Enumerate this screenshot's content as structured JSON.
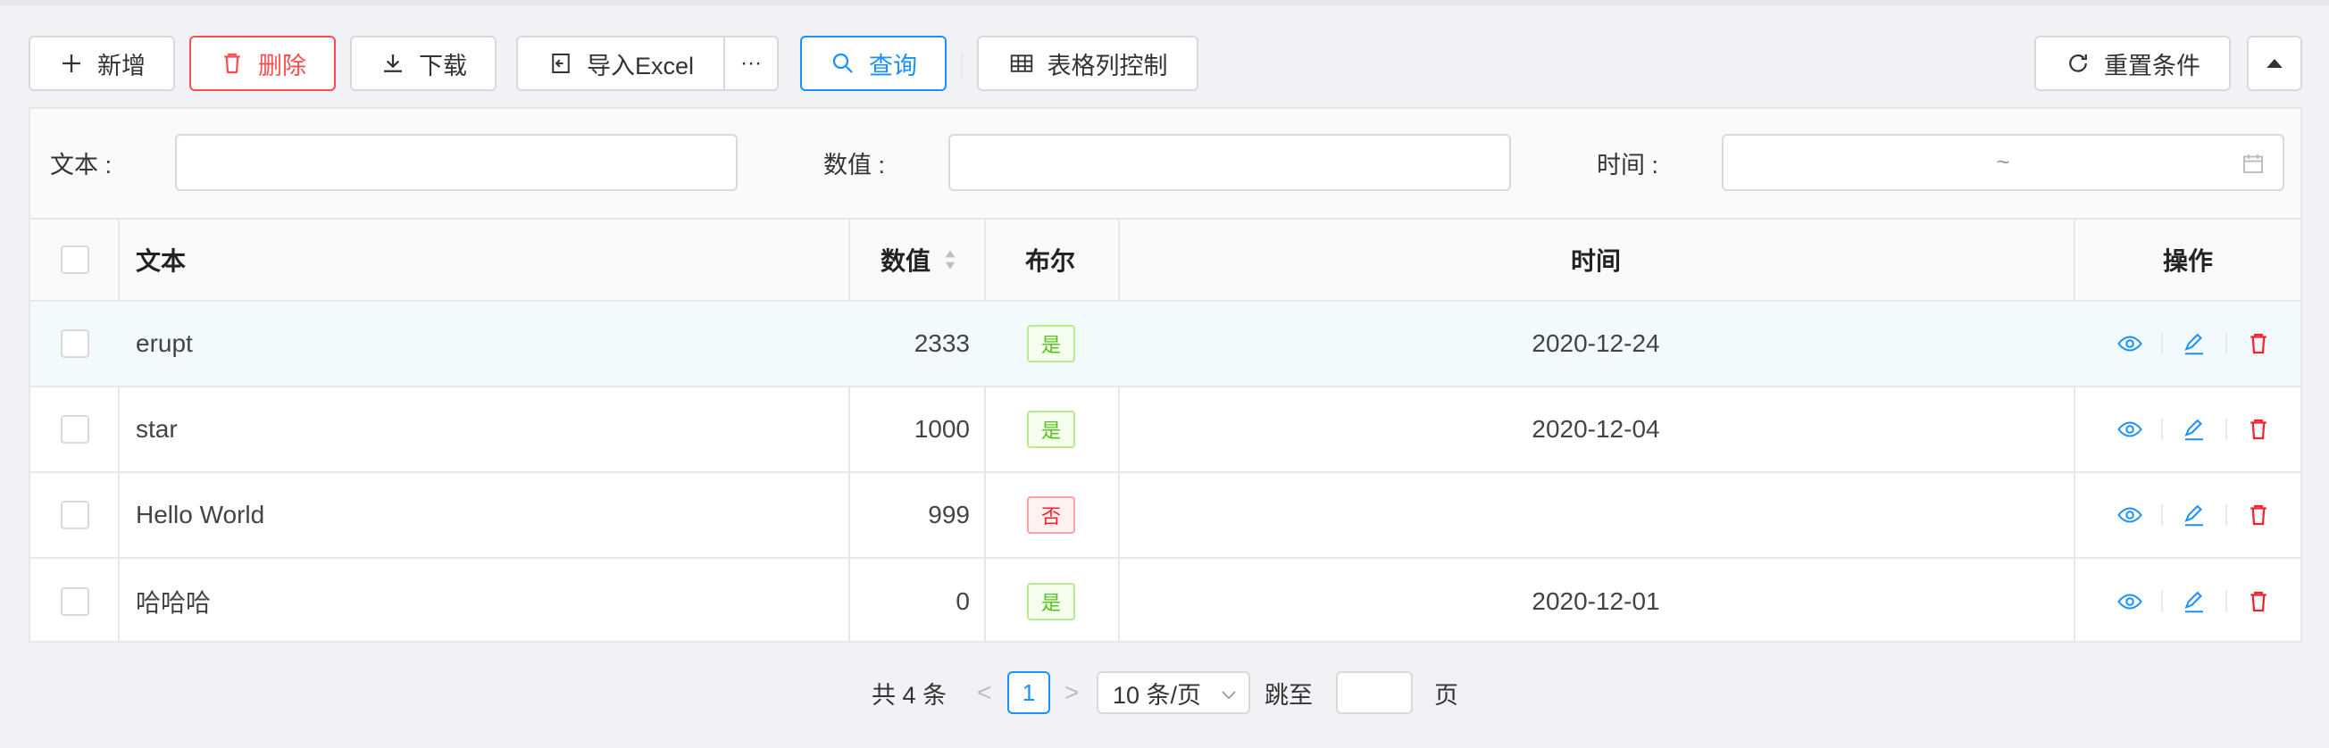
{
  "toolbar": {
    "add_label": "新增",
    "delete_label": "删除",
    "download_label": "下载",
    "import_label": "导入Excel",
    "more_label": "···",
    "query_label": "查询",
    "columns_label": "表格列控制",
    "reset_label": "重置条件"
  },
  "search": {
    "text_label": "文本 :",
    "number_label": "数值 :",
    "time_label": "时间 :",
    "text_value": "",
    "number_value": "",
    "time_range_sep": "~"
  },
  "table": {
    "headers": {
      "text": "文本",
      "number": "数值",
      "bool": "布尔",
      "time": "时间",
      "action": "操作"
    },
    "rows": [
      {
        "text": "erupt",
        "number": "2333",
        "bool": "是",
        "bool_true": true,
        "time": "2020-12-24"
      },
      {
        "text": "star",
        "number": "1000",
        "bool": "是",
        "bool_true": true,
        "time": "2020-12-04"
      },
      {
        "text": "Hello World",
        "number": "999",
        "bool": "否",
        "bool_true": false,
        "time": ""
      },
      {
        "text": "哈哈哈",
        "number": "0",
        "bool": "是",
        "bool_true": true,
        "time": "2020-12-01"
      }
    ]
  },
  "pagination": {
    "total_label": "共 4 条",
    "current_page": "1",
    "page_size": "10 条/页",
    "jump_label": "跳至",
    "page_label": "页",
    "prev": "<",
    "next": ">"
  },
  "colors": {
    "primary": "#1890ff",
    "danger": "#ff4d4f",
    "success": "#52c41a"
  }
}
